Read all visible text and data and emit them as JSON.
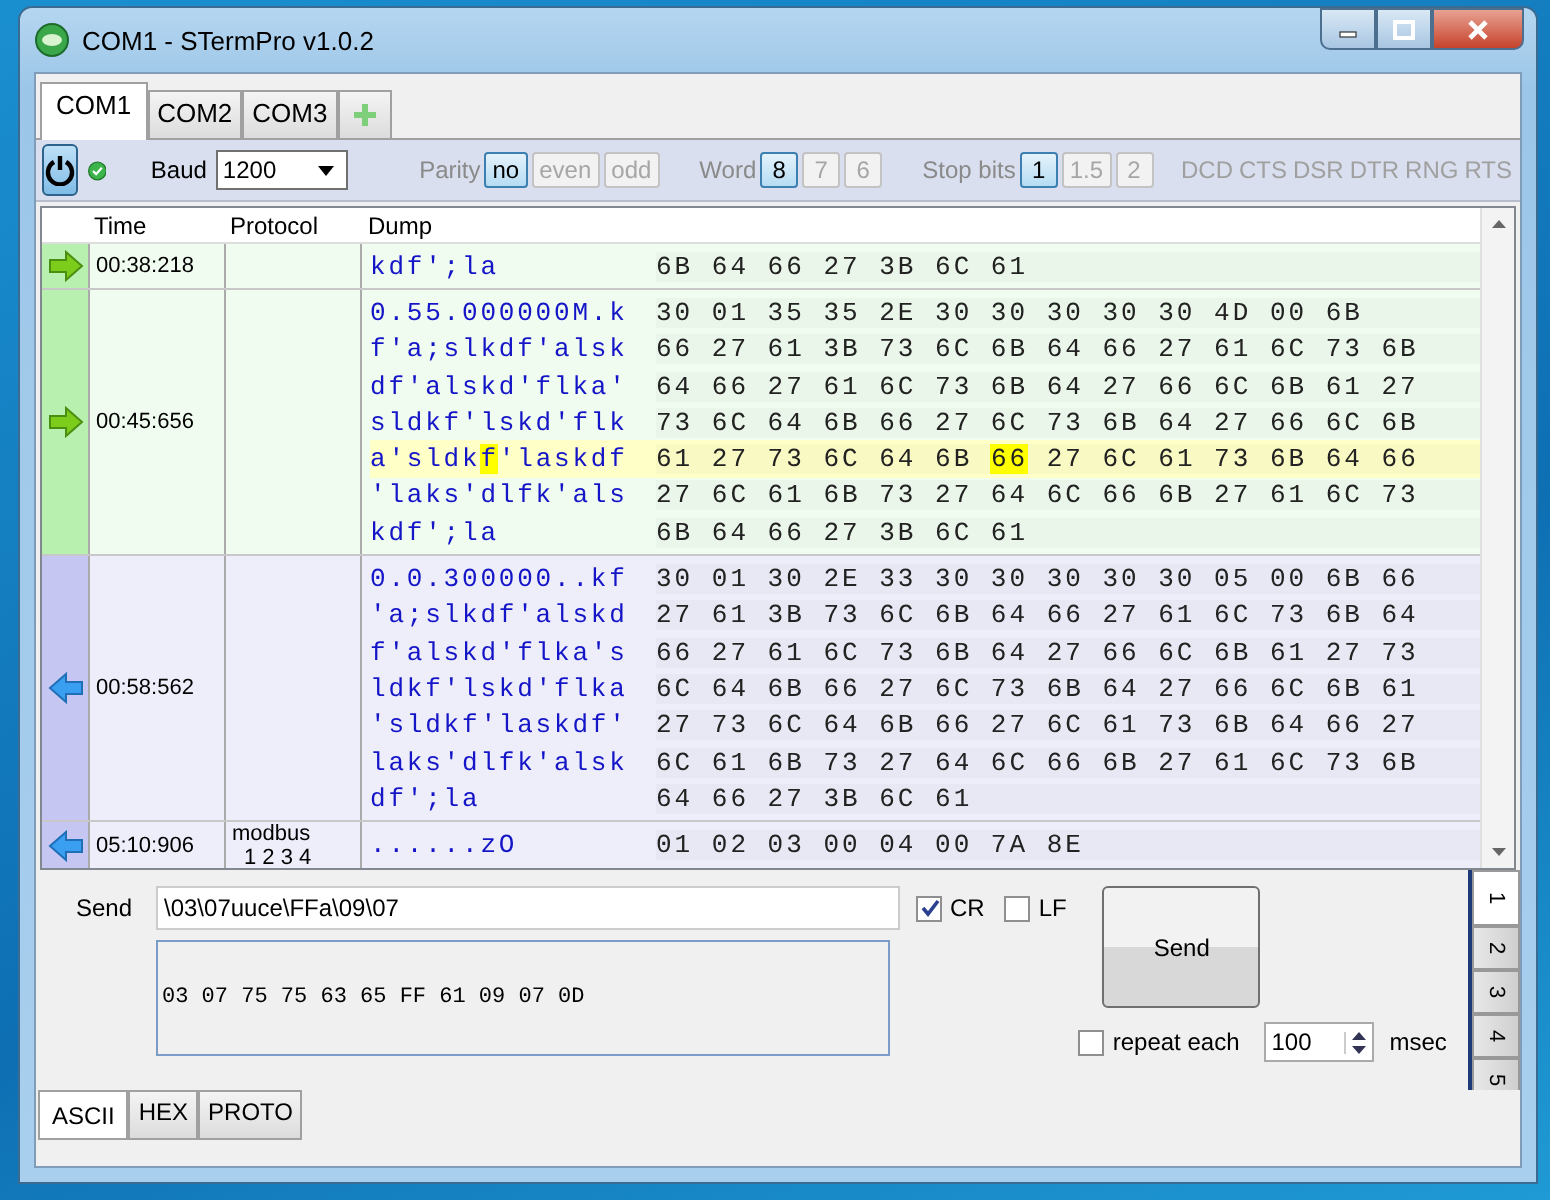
{
  "window": {
    "title": "COM1 - STermPro v1.0.2"
  },
  "tabs": [
    {
      "label": "COM1",
      "selected": true
    },
    {
      "label": "COM2",
      "selected": false
    },
    {
      "label": "COM3",
      "selected": false
    }
  ],
  "toolbar": {
    "connected": true,
    "baud_label": "Baud",
    "baud": "1200",
    "groups": [
      {
        "label": "Parity",
        "options": [
          {
            "label": "no",
            "selected": true
          },
          {
            "label": "even",
            "selected": false
          },
          {
            "label": "odd",
            "selected": false
          }
        ]
      },
      {
        "label": "Word",
        "options": [
          {
            "label": "8",
            "selected": true
          },
          {
            "label": "7",
            "selected": false
          },
          {
            "label": "6",
            "selected": false
          }
        ]
      },
      {
        "label": "Stop bits",
        "options": [
          {
            "label": "1",
            "selected": true
          },
          {
            "label": "1.5",
            "selected": false
          },
          {
            "label": "2",
            "selected": false
          }
        ]
      }
    ],
    "signals": [
      {
        "label": "DCD",
        "on": false
      },
      {
        "label": "CTS",
        "on": false
      },
      {
        "label": "DSR",
        "on": false
      },
      {
        "label": "DTR",
        "on": false
      },
      {
        "label": "RNG",
        "on": false
      },
      {
        "label": "RTS",
        "on": false
      }
    ]
  },
  "log": {
    "columns": [
      "Time",
      "Protocol",
      "Dump"
    ],
    "rows": [
      {
        "kind": "rx",
        "time": "00:38:218",
        "protocol": [],
        "lines": [
          {
            "selected": false,
            "ascii": [
              {
                "text": "kdf';la",
                "marked": false
              }
            ],
            "hex": [
              {
                "text": "6B 64 66 27 3B 6C 61",
                "marked": false
              }
            ]
          }
        ]
      },
      {
        "kind": "rx",
        "time": "00:45:656",
        "protocol": [],
        "lines": [
          {
            "selected": false,
            "ascii": [
              {
                "text": "0.55.000000M.k",
                "marked": false
              }
            ],
            "hex": [
              {
                "text": "30 01 35 35 2E 30 30 30 30 30 4D 00 6B",
                "marked": false
              }
            ]
          },
          {
            "selected": false,
            "ascii": [
              {
                "text": "f'a;slkdf'alsk",
                "marked": false
              }
            ],
            "hex": [
              {
                "text": "66 27 61 3B 73 6C 6B 64 66 27 61 6C 73 6B",
                "marked": false
              }
            ]
          },
          {
            "selected": false,
            "ascii": [
              {
                "text": "df'alskd'flka'",
                "marked": false
              }
            ],
            "hex": [
              {
                "text": "64 66 27 61 6C 73 6B 64 27 66 6C 6B 61 27",
                "marked": false
              }
            ]
          },
          {
            "selected": false,
            "ascii": [
              {
                "text": "sldkf'lskd'flk",
                "marked": false
              }
            ],
            "hex": [
              {
                "text": "73 6C 64 6B 66 27 6C 73 6B 64 27 66 6C 6B",
                "marked": false
              }
            ]
          },
          {
            "selected": true,
            "ascii": [
              {
                "text": "a'sldk",
                "marked": false
              },
              {
                "text": "f",
                "marked": true
              },
              {
                "text": "'laskdf",
                "marked": false
              }
            ],
            "hex": [
              {
                "text": "61 27 73 6C 64 6B ",
                "marked": false
              },
              {
                "text": "66",
                "marked": true
              },
              {
                "text": " 27 6C 61 73 6B 64 66",
                "marked": false
              }
            ]
          },
          {
            "selected": false,
            "ascii": [
              {
                "text": "'laks'dlfk'als",
                "marked": false
              }
            ],
            "hex": [
              {
                "text": "27 6C 61 6B 73 27 64 6C 66 6B 27 61 6C 73",
                "marked": false
              }
            ]
          },
          {
            "selected": false,
            "ascii": [
              {
                "text": "kdf';la",
                "marked": false
              }
            ],
            "hex": [
              {
                "text": "6B 64 66 27 3B 6C 61",
                "marked": false
              }
            ]
          }
        ]
      },
      {
        "kind": "tx",
        "time": "00:58:562",
        "protocol": [],
        "lines": [
          {
            "selected": false,
            "ascii": [
              {
                "text": "0.0.300000..kf",
                "marked": false
              }
            ],
            "hex": [
              {
                "text": "30 01 30 2E 33 30 30 30 30 30 05 00 6B 66",
                "marked": false
              }
            ]
          },
          {
            "selected": false,
            "ascii": [
              {
                "text": "'a;slkdf'alskd",
                "marked": false
              }
            ],
            "hex": [
              {
                "text": "27 61 3B 73 6C 6B 64 66 27 61 6C 73 6B 64",
                "marked": false
              }
            ]
          },
          {
            "selected": false,
            "ascii": [
              {
                "text": "f'alskd'flka's",
                "marked": false
              }
            ],
            "hex": [
              {
                "text": "66 27 61 6C 73 6B 64 27 66 6C 6B 61 27 73",
                "marked": false
              }
            ]
          },
          {
            "selected": false,
            "ascii": [
              {
                "text": "ldkf'lskd'flka",
                "marked": false
              }
            ],
            "hex": [
              {
                "text": "6C 64 6B 66 27 6C 73 6B 64 27 66 6C 6B 61",
                "marked": false
              }
            ]
          },
          {
            "selected": false,
            "ascii": [
              {
                "text": "'sldkf'laskdf'",
                "marked": false
              }
            ],
            "hex": [
              {
                "text": "27 73 6C 64 6B 66 27 6C 61 73 6B 64 66 27",
                "marked": false
              }
            ]
          },
          {
            "selected": false,
            "ascii": [
              {
                "text": "laks'dlfk'alsk",
                "marked": false
              }
            ],
            "hex": [
              {
                "text": "6C 61 6B 73 27 64 6C 66 6B 27 61 6C 73 6B",
                "marked": false
              }
            ]
          },
          {
            "selected": false,
            "ascii": [
              {
                "text": "df';la",
                "marked": false
              }
            ],
            "hex": [
              {
                "text": "64 66 27 3B 6C 61",
                "marked": false
              }
            ]
          }
        ]
      },
      {
        "kind": "tx",
        "time": "05:10:906",
        "protocol": [
          "modbus",
          "1 2 3 4"
        ],
        "lines": [
          {
            "selected": false,
            "ascii": [
              {
                "text": "......zO",
                "marked": false
              }
            ],
            "hex": [
              {
                "text": "01 02 03 00 04 00 7A 8E",
                "marked": false
              }
            ]
          }
        ]
      }
    ]
  },
  "send": {
    "label": "Send",
    "value": "\\03\\07uuce\\FFa\\09\\07",
    "preview": "03 07 75 75 63 65 FF 61 09 07 0D",
    "options": [
      {
        "label": "CR",
        "checked": true
      },
      {
        "label": "LF",
        "checked": false
      }
    ],
    "button": "Send",
    "repeat": {
      "label": "repeat each",
      "checked": false,
      "value": "100",
      "unit": "msec"
    }
  },
  "mode_tabs": [
    {
      "label": "ASCII",
      "selected": true
    },
    {
      "label": "HEX",
      "selected": false
    },
    {
      "label": "PROTO",
      "selected": false
    }
  ],
  "side_tabs": [
    {
      "label": "1",
      "selected": true
    },
    {
      "label": "2",
      "selected": false
    },
    {
      "label": "3",
      "selected": false
    },
    {
      "label": "4",
      "selected": false
    },
    {
      "label": "5",
      "selected": false
    }
  ]
}
